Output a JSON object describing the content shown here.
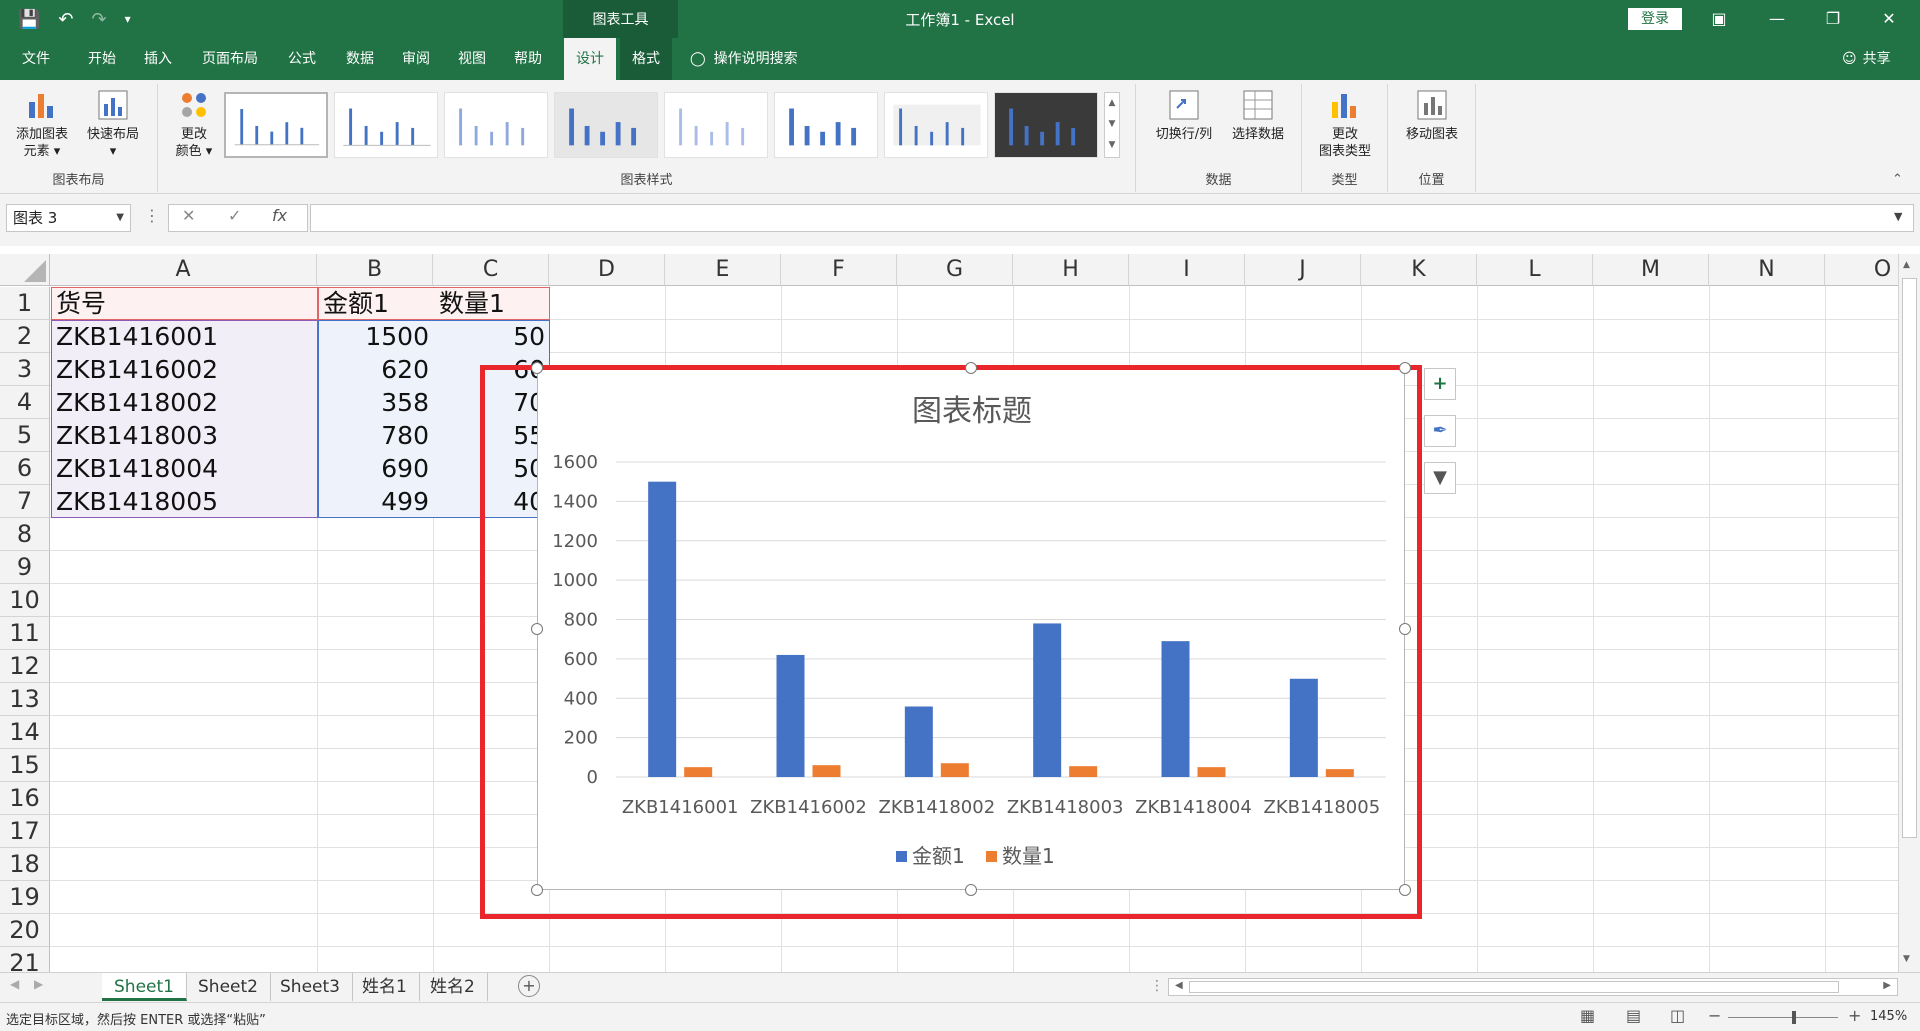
{
  "window": {
    "context_tools": "图表工具",
    "title": "工作簿1  -  Excel",
    "login": "登录"
  },
  "tabs": [
    "文件",
    "开始",
    "插入",
    "页面布局",
    "公式",
    "数据",
    "审阅",
    "视图",
    "帮助",
    "设计",
    "格式"
  ],
  "tell_me": "操作说明搜索",
  "share": "共享",
  "ribbon": {
    "add_element": "添加图表\n元素",
    "quick_layout": "快速布局",
    "change_color": "更改\n颜色",
    "group_layout": "图表布局",
    "group_styles": "图表样式",
    "switch_row_col": "切换行/列",
    "select_data": "选择数据",
    "group_data": "数据",
    "change_type": "更改\n图表类型",
    "group_type": "类型",
    "move_chart": "移动图表",
    "group_location": "位置"
  },
  "formula": {
    "name_box": "图表 3",
    "fx": "fx",
    "value": ""
  },
  "grid": {
    "columns": [
      "A",
      "B",
      "C",
      "D",
      "E",
      "F",
      "G",
      "H",
      "I",
      "J",
      "K",
      "L",
      "M",
      "N",
      "O"
    ],
    "rows": [
      "1",
      "2",
      "3",
      "4",
      "5",
      "6",
      "7",
      "8",
      "9",
      "10",
      "11",
      "12",
      "13",
      "14",
      "15",
      "16",
      "17",
      "18",
      "19",
      "20",
      "21"
    ],
    "headers": [
      "货号",
      "金额1",
      "数量1"
    ],
    "data": [
      [
        "ZKB1416001",
        "1500",
        "50"
      ],
      [
        "ZKB1416002",
        "620",
        "60"
      ],
      [
        "ZKB1418002",
        "358",
        "70"
      ],
      [
        "ZKB1418003",
        "780",
        "55"
      ],
      [
        "ZKB1418004",
        "690",
        "50"
      ],
      [
        "ZKB1418005",
        "499",
        "40"
      ]
    ]
  },
  "chart_data": {
    "type": "bar",
    "title": "图表标题",
    "categories": [
      "ZKB1416001",
      "ZKB1416002",
      "ZKB1418002",
      "ZKB1418003",
      "ZKB1418004",
      "ZKB1418005"
    ],
    "series": [
      {
        "name": "金额1",
        "values": [
          1500,
          620,
          358,
          780,
          690,
          499
        ],
        "color": "#4472c4"
      },
      {
        "name": "数量1",
        "values": [
          50,
          60,
          70,
          55,
          50,
          40
        ],
        "color": "#ed7d31"
      }
    ],
    "ylim": [
      0,
      1600
    ],
    "yticks": [
      "0",
      "200",
      "400",
      "600",
      "800",
      "1000",
      "1200",
      "1400",
      "1600"
    ],
    "grid": true,
    "legend": "bottom"
  },
  "sheets": [
    "Sheet1",
    "Sheet2",
    "Sheet3",
    "姓名1",
    "姓名2"
  ],
  "status": {
    "message": "选定目标区域，然后按 ENTER 或选择“粘贴”",
    "zoom": "145%"
  }
}
